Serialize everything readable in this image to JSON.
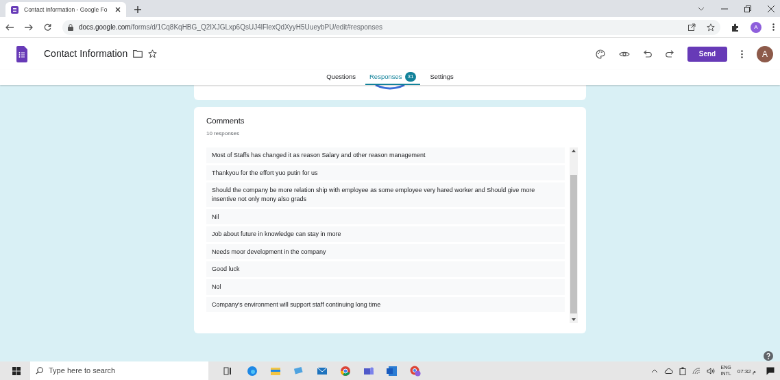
{
  "browser": {
    "tab_title": "Contact Information - Google Fo",
    "url_host": "docs.google.com",
    "url_path": "/forms/d/1Cq8KqHBG_Q2IXJGLxp6QsUJ4lFlexQdXyyH5UueybPU/edit#responses",
    "profile": "A"
  },
  "form": {
    "title": "Contact Information",
    "send": "Send",
    "avatar": "A"
  },
  "tabs": [
    {
      "label": "Questions",
      "selected": false
    },
    {
      "label": "Responses",
      "selected": true,
      "badge": "31"
    },
    {
      "label": "Settings",
      "selected": false
    }
  ],
  "comments": {
    "title": "Comments",
    "count": "10 responses",
    "items": [
      "Most of Staffs has changed it as reason Salary and other reason management",
      "Thankyou for the effort yuo putin for us",
      "Should the company be more relation ship with employee as some employee very hared worker and Should give more insentive not only mony also grads",
      "Nil",
      "Job about future in knowledge can stay in more",
      "Needs moor development in the company",
      "Good luck",
      "Nol",
      "Company's environment will support staff continuing long time"
    ]
  },
  "taskbar": {
    "search_placeholder": "Type here to search",
    "lang": "ENG",
    "layout": "INTL",
    "time": "07:32 م"
  }
}
